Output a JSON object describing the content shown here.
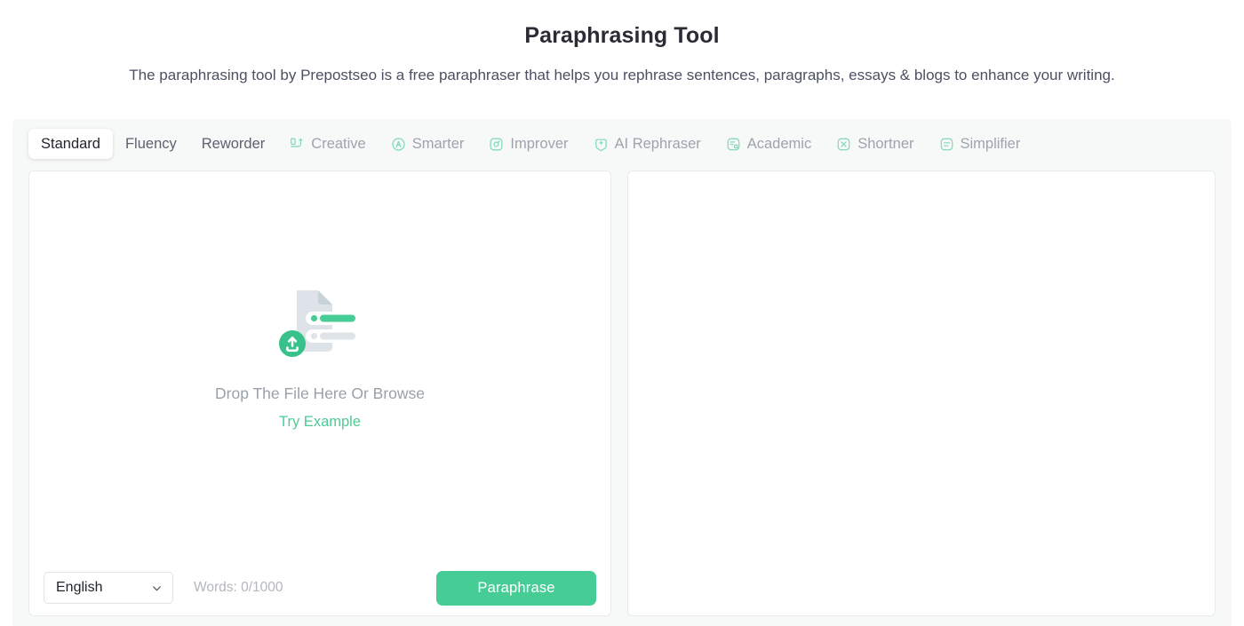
{
  "header": {
    "title": "Paraphrasing Tool",
    "subtitle": "The paraphrasing tool by Prepostseo is a free paraphraser that helps you rephrase sentences, paragraphs, essays & blogs to enhance your writing."
  },
  "tabs": [
    {
      "label": "Standard",
      "icon": null,
      "state": "active"
    },
    {
      "label": "Fluency",
      "icon": null,
      "state": "plain"
    },
    {
      "label": "Reworder",
      "icon": null,
      "state": "plain"
    },
    {
      "label": "Creative",
      "icon": "creative-icon",
      "state": "locked"
    },
    {
      "label": "Smarter",
      "icon": "smarter-icon",
      "state": "locked"
    },
    {
      "label": "Improver",
      "icon": "improver-icon",
      "state": "locked"
    },
    {
      "label": "AI Rephraser",
      "icon": "ai-rephraser-icon",
      "state": "locked"
    },
    {
      "label": "Academic",
      "icon": "academic-icon",
      "state": "locked"
    },
    {
      "label": "Shortner",
      "icon": "shortner-icon",
      "state": "locked"
    },
    {
      "label": "Simplifier",
      "icon": "simplifier-icon",
      "state": "locked"
    }
  ],
  "editor": {
    "dropzone_text": "Drop The File Here Or Browse",
    "try_example_label": "Try Example",
    "upload_icon": "file-upload-illustration"
  },
  "toolbar": {
    "language_value": "English",
    "language_chevron": "chevron-down-icon",
    "word_count": "Words: 0/1000",
    "paraphrase_label": "Paraphrase"
  },
  "output": {
    "placeholder": ""
  },
  "colors": {
    "accent_green": "#46cd96",
    "link_green": "#4ecb94",
    "icon_green": "#7fd9b4",
    "muted_text": "#9ba0a8",
    "card_bg": "#f7f8f8",
    "title_text": "#2b2b35"
  }
}
